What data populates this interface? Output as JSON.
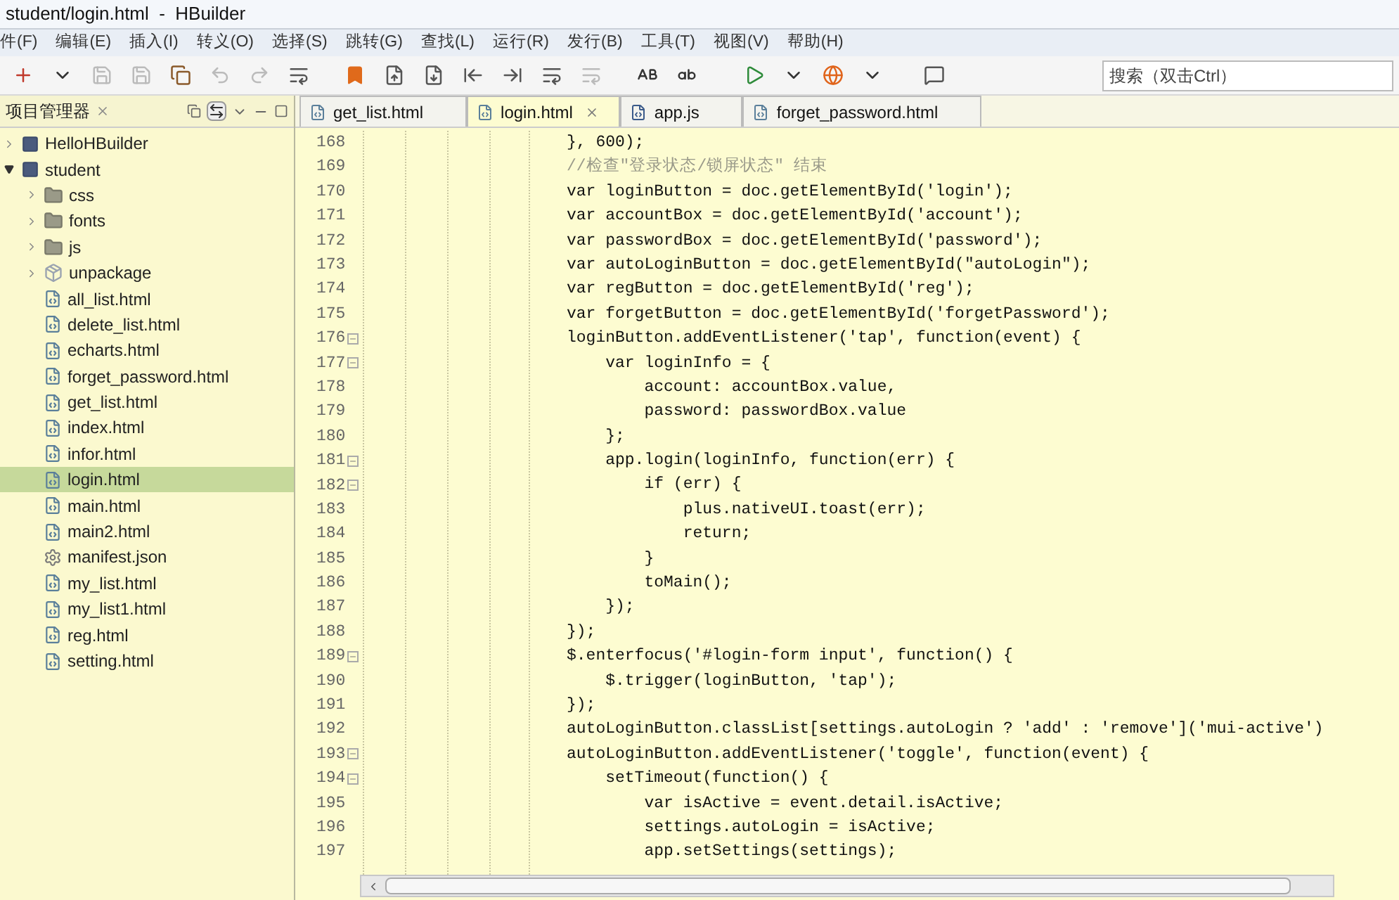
{
  "window": {
    "title": "student/login.html  -  HBuilder"
  },
  "menu": [
    "件(F)",
    "编辑(E)",
    "插入(I)",
    "转义(O)",
    "选择(S)",
    "跳转(G)",
    "查找(L)",
    "运行(R)",
    "发行(B)",
    "工具(T)",
    "视图(V)",
    "帮助(H)"
  ],
  "search": {
    "placeholder": "搜索（双击Ctrl）"
  },
  "sidebar": {
    "title": "项目管理器",
    "items": [
      {
        "label": "HelloHBuilder",
        "kind": "project",
        "expanded": false,
        "selected": false
      },
      {
        "label": "student",
        "kind": "project",
        "expanded": true,
        "selected": false,
        "children": [
          {
            "label": "css",
            "kind": "folder",
            "expanded": false,
            "selected": false
          },
          {
            "label": "fonts",
            "kind": "folder",
            "expanded": false,
            "selected": false
          },
          {
            "label": "js",
            "kind": "folder",
            "expanded": false,
            "selected": false
          },
          {
            "label": "unpackage",
            "kind": "package",
            "expanded": false,
            "selected": false
          },
          {
            "label": "all_list.html",
            "kind": "file",
            "selected": false
          },
          {
            "label": "delete_list.html",
            "kind": "file",
            "selected": false
          },
          {
            "label": "echarts.html",
            "kind": "file",
            "selected": false
          },
          {
            "label": "forget_password.html",
            "kind": "file",
            "selected": false
          },
          {
            "label": "get_list.html",
            "kind": "file",
            "selected": false
          },
          {
            "label": "index.html",
            "kind": "file",
            "selected": false
          },
          {
            "label": "infor.html",
            "kind": "file",
            "selected": false
          },
          {
            "label": "login.html",
            "kind": "file",
            "selected": true
          },
          {
            "label": "main.html",
            "kind": "file",
            "selected": false
          },
          {
            "label": "main2.html",
            "kind": "file",
            "selected": false
          },
          {
            "label": "manifest.json",
            "kind": "config",
            "selected": false
          },
          {
            "label": "my_list.html",
            "kind": "file",
            "selected": false
          },
          {
            "label": "my_list1.html",
            "kind": "file",
            "selected": false
          },
          {
            "label": "reg.html",
            "kind": "file",
            "selected": false
          },
          {
            "label": "setting.html",
            "kind": "file",
            "selected": false
          }
        ]
      }
    ]
  },
  "tabs": [
    {
      "label": "get_list.html",
      "kind": "html",
      "selected": false
    },
    {
      "label": "login.html",
      "kind": "html",
      "selected": true
    },
    {
      "label": "app.js",
      "kind": "js",
      "selected": false
    },
    {
      "label": "forget_password.html",
      "kind": "html",
      "selected": false
    }
  ],
  "editor": {
    "lines": [
      {
        "number": "168",
        "text": "}, 600);",
        "kind": "code",
        "fold": false
      },
      {
        "number": "169",
        "text": "//检查\"登录状态/锁屏状态\" 结束",
        "kind": "comment",
        "fold": false
      },
      {
        "number": "170",
        "text": "var loginButton = doc.getElementById('login');",
        "kind": "code",
        "fold": false
      },
      {
        "number": "171",
        "text": "var accountBox = doc.getElementById('account');",
        "kind": "code",
        "fold": false
      },
      {
        "number": "172",
        "text": "var passwordBox = doc.getElementById('password');",
        "kind": "code",
        "fold": false
      },
      {
        "number": "173",
        "text": "var autoLoginButton = doc.getElementById(\"autoLogin\");",
        "kind": "code",
        "fold": false
      },
      {
        "number": "174",
        "text": "var regButton = doc.getElementById('reg');",
        "kind": "code",
        "fold": false
      },
      {
        "number": "175",
        "text": "var forgetButton = doc.getElementById('forgetPassword');",
        "kind": "code",
        "fold": false
      },
      {
        "number": "176",
        "text": "loginButton.addEventListener('tap', function(event) {",
        "kind": "code",
        "fold": true
      },
      {
        "number": "177",
        "text": "    var loginInfo = {",
        "kind": "code",
        "fold": true
      },
      {
        "number": "178",
        "text": "        account: accountBox.value,",
        "kind": "code",
        "fold": false
      },
      {
        "number": "179",
        "text": "        password: passwordBox.value",
        "kind": "code",
        "fold": false
      },
      {
        "number": "180",
        "text": "    };",
        "kind": "code",
        "fold": false
      },
      {
        "number": "181",
        "text": "    app.login(loginInfo, function(err) {",
        "kind": "code",
        "fold": true
      },
      {
        "number": "182",
        "text": "        if (err) {",
        "kind": "code",
        "fold": true
      },
      {
        "number": "183",
        "text": "            plus.nativeUI.toast(err);",
        "kind": "code",
        "fold": false
      },
      {
        "number": "184",
        "text": "            return;",
        "kind": "code",
        "fold": false
      },
      {
        "number": "185",
        "text": "        }",
        "kind": "code",
        "fold": false
      },
      {
        "number": "186",
        "text": "        toMain();",
        "kind": "code",
        "fold": false
      },
      {
        "number": "187",
        "text": "    });",
        "kind": "code",
        "fold": false
      },
      {
        "number": "188",
        "text": "});",
        "kind": "code",
        "fold": false
      },
      {
        "number": "189",
        "text": "$.enterfocus('#login-form input', function() {",
        "kind": "code",
        "fold": true
      },
      {
        "number": "190",
        "text": "    $.trigger(loginButton, 'tap');",
        "kind": "code",
        "fold": false
      },
      {
        "number": "191",
        "text": "});",
        "kind": "code",
        "fold": false
      },
      {
        "number": "192",
        "text": "autoLoginButton.classList[settings.autoLogin ? 'add' : 'remove']('mui-active')",
        "kind": "code",
        "fold": false
      },
      {
        "number": "193",
        "text": "autoLoginButton.addEventListener('toggle', function(event) {",
        "kind": "code",
        "fold": true
      },
      {
        "number": "194",
        "text": "    setTimeout(function() {",
        "kind": "code",
        "fold": true
      },
      {
        "number": "195",
        "text": "        var isActive = event.detail.isActive;",
        "kind": "code",
        "fold": false
      },
      {
        "number": "196",
        "text": "        settings.autoLogin = isActive;",
        "kind": "code",
        "fold": false
      },
      {
        "number": "197",
        "text": "        app.setSettings(settings);",
        "kind": "code",
        "fold": false
      }
    ]
  }
}
